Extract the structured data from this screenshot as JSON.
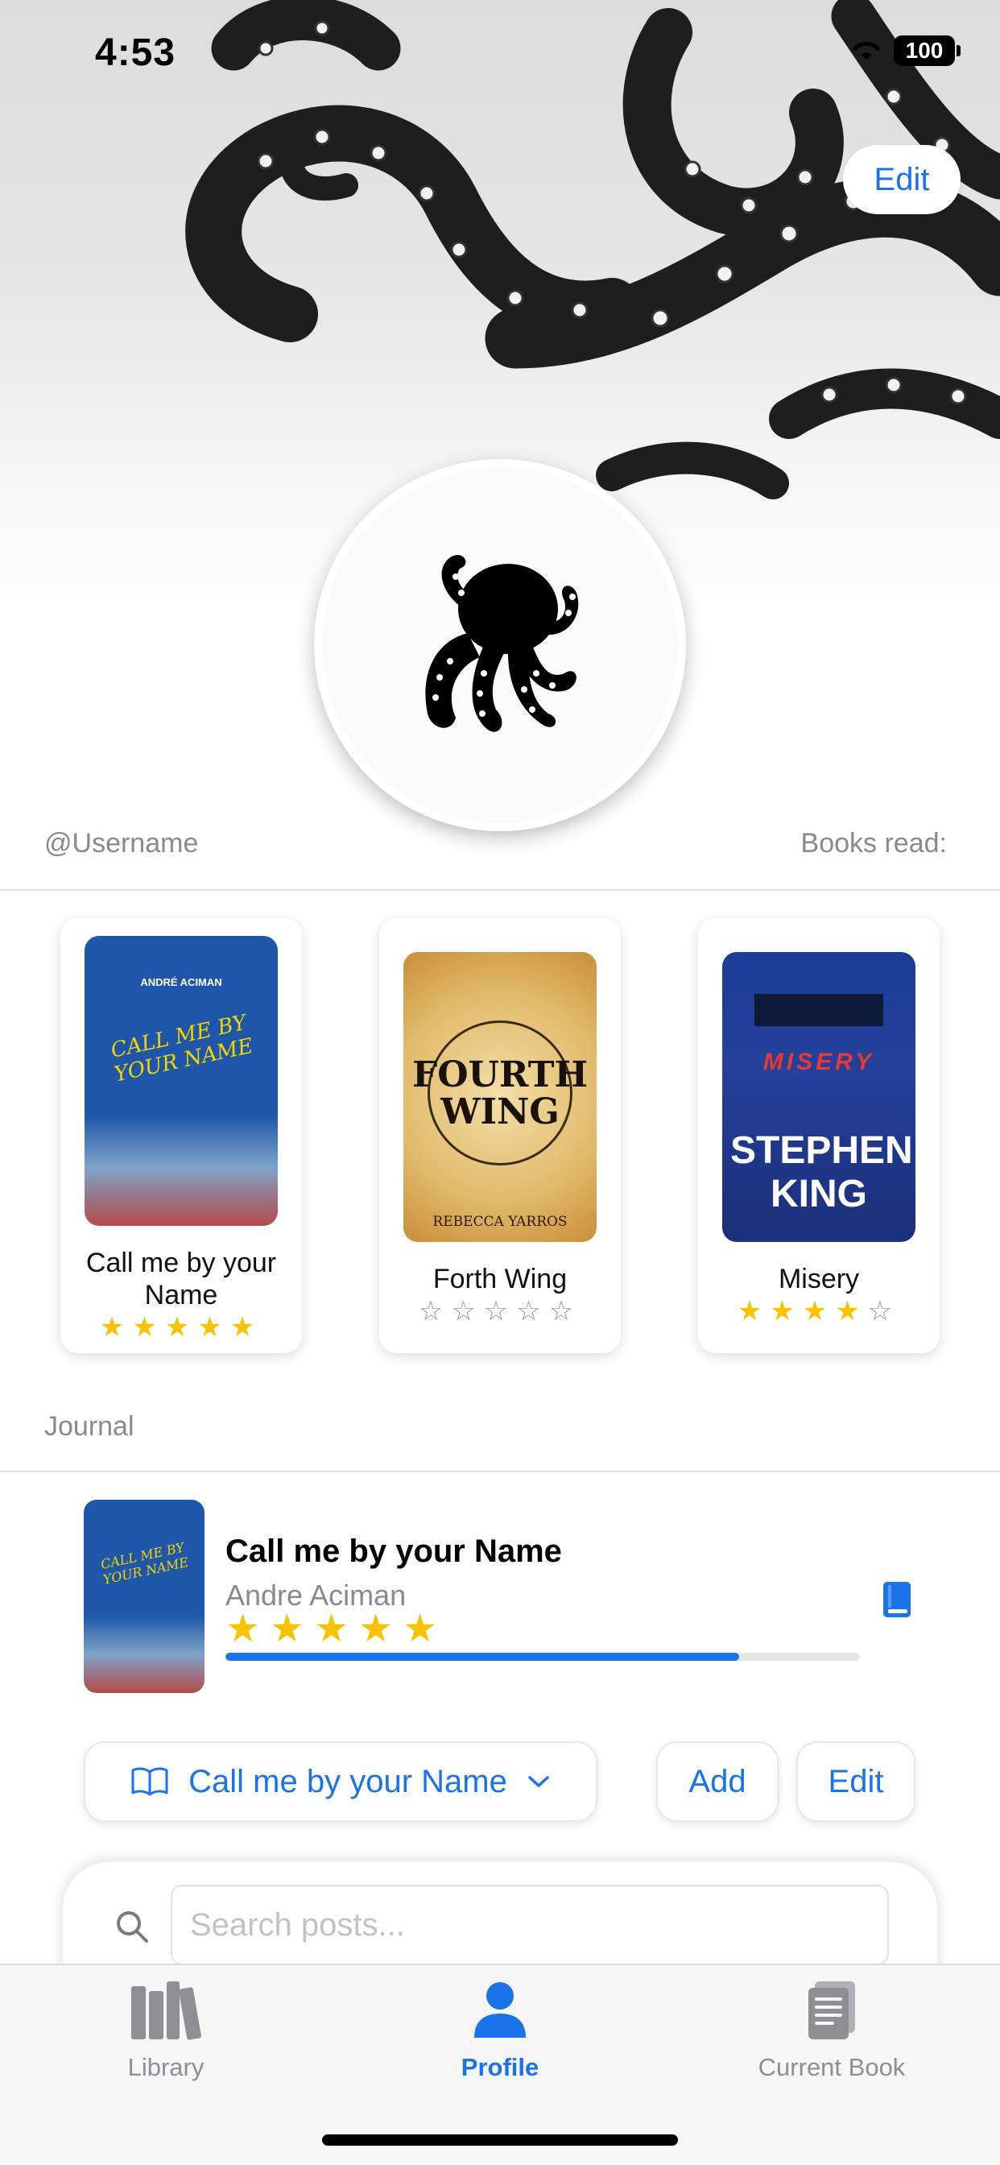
{
  "status_bar": {
    "time": "4:53",
    "battery": "100"
  },
  "header": {
    "edit_label": "Edit"
  },
  "profile": {
    "username": "@Username",
    "books_read_label": "Books read:"
  },
  "books": [
    {
      "title": "Call me by your Name",
      "rating": 5,
      "cover_text_top": "ANDRÉ ACIMAN",
      "cover_text_main": "CALL ME BY YOUR NAME",
      "cover_color": "#1f56a8"
    },
    {
      "title": "Forth Wing",
      "rating": 0,
      "cover_text_main": "FOURTH WING",
      "cover_text_author": "REBECCA YARROS",
      "cover_color": "#e8c98a"
    },
    {
      "title": "Misery",
      "rating": 4,
      "cover_text_main": "MISERY",
      "cover_text_author": "STEPHEN KING",
      "cover_color": "#1a3f99"
    }
  ],
  "journal": {
    "label": "Journal",
    "current": {
      "title": "Call me by your Name",
      "author": "Andre Aciman",
      "rating": 5,
      "progress": 0.81
    },
    "picker_label": "Call me by your Name",
    "add_label": "Add",
    "edit_label": "Edit",
    "search_placeholder": "Search posts..."
  },
  "tabs": [
    {
      "label": "Library",
      "icon": "books-icon",
      "active": false
    },
    {
      "label": "Profile",
      "icon": "person-icon",
      "active": true
    },
    {
      "label": "Current Book",
      "icon": "document-stack-icon",
      "active": false
    }
  ],
  "colors": {
    "accent": "#1a73e8",
    "star": "#f7c300",
    "star_empty": "#9a9a9a"
  }
}
